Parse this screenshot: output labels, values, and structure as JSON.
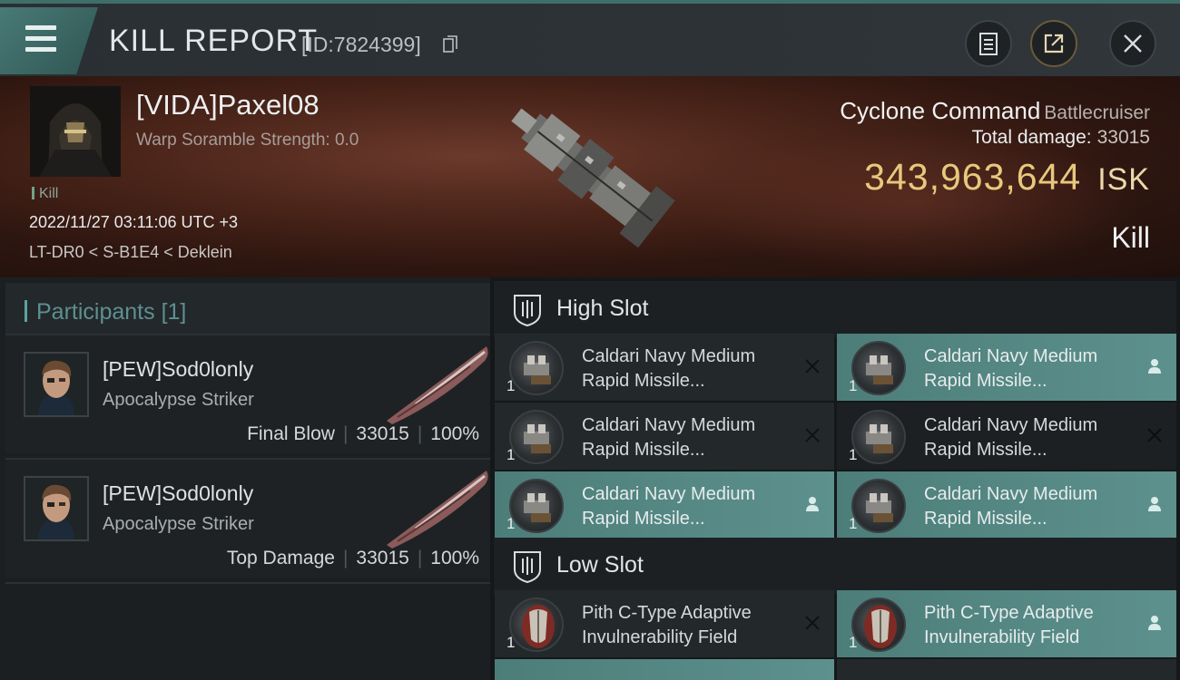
{
  "header": {
    "title": "KILL REPORT",
    "report_id": "[ID:7824399]",
    "icons": [
      "menu-icon",
      "copy-icon",
      "clipboard-icon",
      "share-icon",
      "close-icon"
    ]
  },
  "victim": {
    "name": "[VIDA]Paxel08",
    "scramble": "Warp Soramble Strength: 0.0",
    "tag": "Kill",
    "datetime": "2022/11/27 03:11:06 UTC +3",
    "location": "LT-DR0 < S-B1E4 < Deklein",
    "ship_name": "Cyclone Command",
    "ship_class": "Battlecruiser",
    "damage_label": "Total damage:",
    "damage_value": "33015",
    "isk_value": "343,963,644",
    "isk_unit": "ISK",
    "result": "Kill"
  },
  "participants": {
    "title": "Participants",
    "count": "[1]",
    "items": [
      {
        "name": "[PEW]Sod0lonly",
        "ship": "Apocalypse Striker",
        "role": "Final Blow",
        "damage": "33015",
        "percent": "100%"
      },
      {
        "name": "[PEW]Sod0lonly",
        "ship": "Apocalypse Striker",
        "role": "Top Damage",
        "damage": "33015",
        "percent": "100%"
      }
    ]
  },
  "fitting": {
    "high_slot": {
      "label": "High Slot",
      "modules": [
        {
          "line1": "Caldari Navy Medium",
          "line2": "Rapid Missile...",
          "qty": "1",
          "action": "close-icon"
        },
        {
          "line1": "Caldari Navy Medium",
          "line2": "Rapid Missile...",
          "qty": "1",
          "action": "person-icon"
        },
        {
          "line1": "Caldari Navy Medium",
          "line2": "Rapid Missile...",
          "qty": "1",
          "action": "close-icon"
        },
        {
          "line1": "Caldari Navy Medium",
          "line2": "Rapid Missile...",
          "qty": "1",
          "action": "close-icon"
        },
        {
          "line1": "Caldari Navy Medium",
          "line2": "Rapid Missile...",
          "qty": "1",
          "action": "person-icon"
        },
        {
          "line1": "Caldari Navy Medium",
          "line2": "Rapid Missile...",
          "qty": "1",
          "action": "person-icon"
        }
      ]
    },
    "low_slot": {
      "label": "Low Slot",
      "modules": [
        {
          "line1": "Pith C-Type Adaptive",
          "line2": "Invulnerability Field",
          "qty": "1",
          "action": "close-icon"
        },
        {
          "line1": "Pith C-Type Adaptive",
          "line2": "Invulnerability Field",
          "qty": "1",
          "action": "person-icon"
        }
      ]
    }
  },
  "colors": {
    "accent": "#4c7d79",
    "isk": "#e8c87c",
    "participants_title": "#5e8f91"
  }
}
